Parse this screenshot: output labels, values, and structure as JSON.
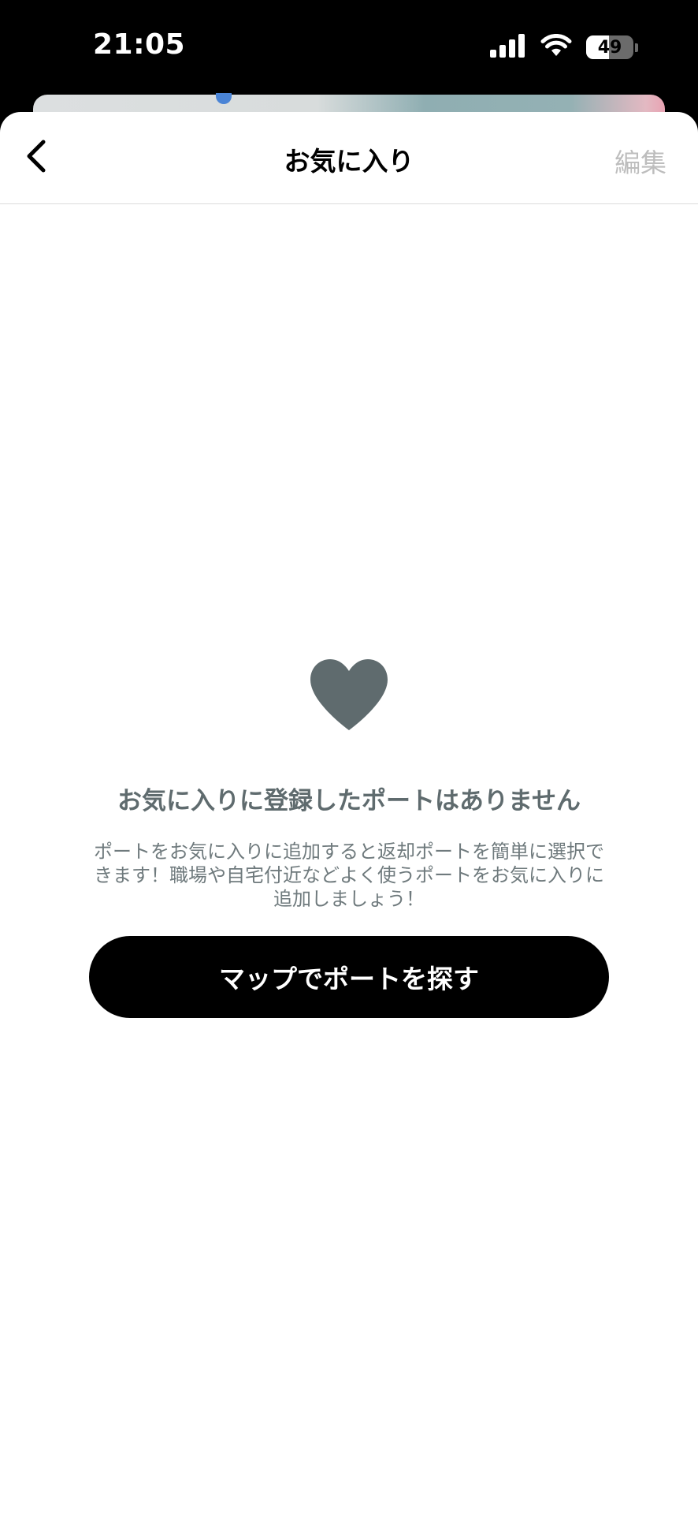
{
  "status_bar": {
    "time": "21:05",
    "battery_level": "49",
    "battery_fraction": 0.49
  },
  "nav": {
    "title": "お気に入り",
    "edit_label": "編集",
    "back_icon": "chevron-left-icon"
  },
  "empty_state": {
    "icon": "heart-icon",
    "icon_color": "#5f6b6e",
    "title": "お気に入りに登録したポートはありません",
    "description": "ポートをお気に入りに追加すると返却ポートを簡単に選択できます！職場や自宅付近などよく使うポートをお気に入りに追加しましょう！",
    "button_label": "マップでポートを探す"
  },
  "colors": {
    "primary_button": "#000000",
    "edit_disabled": "#bdbdbd",
    "muted_text": "#5f6b6e"
  }
}
